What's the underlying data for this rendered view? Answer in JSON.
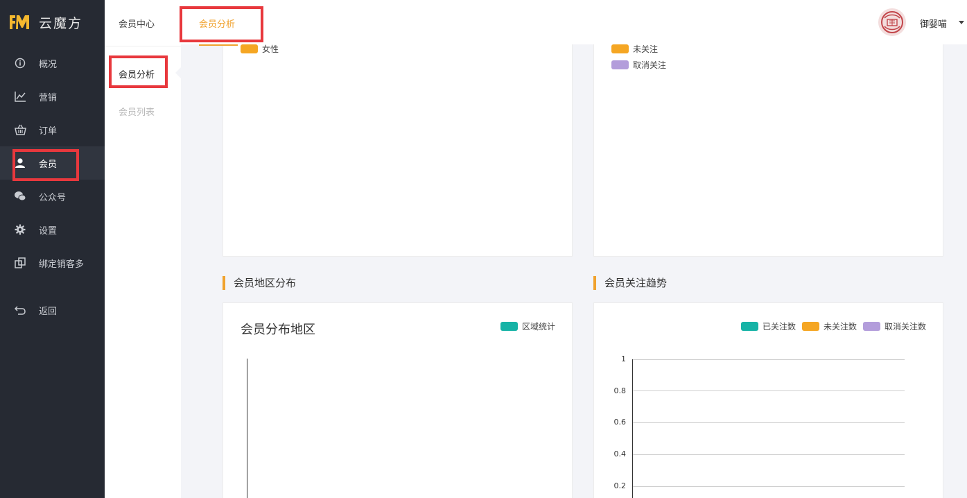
{
  "app": {
    "name": "云魔方"
  },
  "sidebar": {
    "items": [
      {
        "label": "概况",
        "icon": "info-circle-icon"
      },
      {
        "label": "营销",
        "icon": "line-chart-icon"
      },
      {
        "label": "订单",
        "icon": "basket-icon"
      },
      {
        "label": "会员",
        "icon": "user-icon"
      },
      {
        "label": "公众号",
        "icon": "wechat-icon"
      },
      {
        "label": "设置",
        "icon": "gear-icon"
      },
      {
        "label": "绑定销客多",
        "icon": "link-copy-icon"
      }
    ],
    "back": {
      "label": "返回",
      "icon": "return-icon"
    },
    "active_index": 3
  },
  "subnav": {
    "items": [
      {
        "label": "会员分析"
      },
      {
        "label": "会员列表"
      }
    ],
    "active_index": 0
  },
  "topbar": {
    "crumbs": [
      "会员中心",
      "会员分析"
    ],
    "active_crumb": 1,
    "username": "御婴喵"
  },
  "panels": {
    "top_left": {
      "legend": [
        {
          "label": "女性",
          "color": "#f5a623"
        }
      ]
    },
    "top_right": {
      "legend": [
        {
          "label": "未关注",
          "color": "#f5a623"
        },
        {
          "label": "取消关注",
          "color": "#b39ddb"
        }
      ]
    },
    "region": {
      "section_title": "会员地区分布",
      "chart_title": "会员分布地区",
      "legend": [
        {
          "label": "区域统计",
          "color": "#16b3a6"
        }
      ]
    },
    "trend": {
      "section_title": "会员关注趋势",
      "legend": [
        {
          "label": "已关注数",
          "color": "#16b3a6"
        },
        {
          "label": "未关注数",
          "color": "#f5a623"
        },
        {
          "label": "取消关注数",
          "color": "#b39ddb"
        }
      ]
    }
  },
  "chart_data": [
    {
      "type": "bar",
      "title": "会员分布地区",
      "series": [
        {
          "name": "区域统计",
          "values": []
        }
      ],
      "categories": []
    },
    {
      "type": "line",
      "title": "",
      "series": [
        {
          "name": "已关注数",
          "values": []
        },
        {
          "name": "未关注数",
          "values": []
        },
        {
          "name": "取消关注数",
          "values": []
        }
      ],
      "y_ticks": [
        "1",
        "0.8",
        "0.6",
        "0.4",
        "0.2"
      ],
      "ylim": [
        0,
        1
      ],
      "grid": true
    }
  ],
  "colors": {
    "accent": "#f0a22e",
    "highlight": "#e8383d",
    "sidebar_bg": "#262a33"
  }
}
